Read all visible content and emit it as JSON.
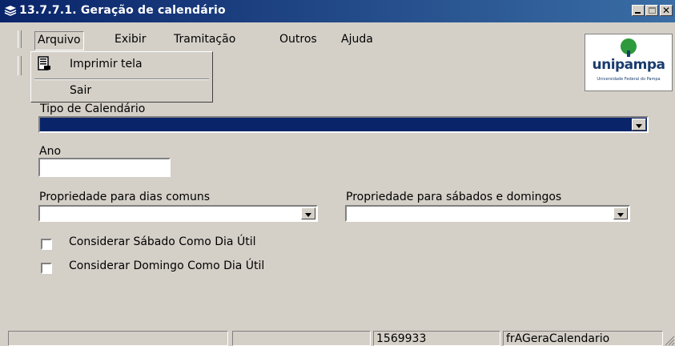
{
  "window": {
    "title": "13.7.7.1. Geração de calendário"
  },
  "menu": {
    "arquivo": "Arquivo",
    "exibir": "Exibir",
    "tramitacao": "Tramitação",
    "outros": "Outros",
    "ajuda": "Ajuda"
  },
  "arquivo_dropdown": {
    "imprimir": "Imprimir tela",
    "sair": "Sair"
  },
  "logo": {
    "name": "unipampa",
    "subtitle": "Universidade Federal do Pampa"
  },
  "form": {
    "tipo_label": "Tipo de Calendário",
    "tipo_value": "",
    "ano_label": "Ano",
    "ano_value": "",
    "prop_comuns_label": "Propriedade para dias comuns",
    "prop_comuns_value": "",
    "prop_fds_label": "Propriedade para sábados e domingos",
    "prop_fds_value": "",
    "chk_sabado_label": "Considerar Sábado Como Dia Útil",
    "chk_domingo_label": "Considerar Domingo Como Dia Útil",
    "chk_sabado_checked": false,
    "chk_domingo_checked": false
  },
  "status": {
    "pane1": "",
    "pane2": "",
    "pane3": "1569933",
    "pane4": "frAGeraCalendario"
  },
  "colors": {
    "titlebar": "#0a246a",
    "selection": "#0a246a",
    "face": "#d4d0c8",
    "logo_green": "#2e9a3b"
  }
}
